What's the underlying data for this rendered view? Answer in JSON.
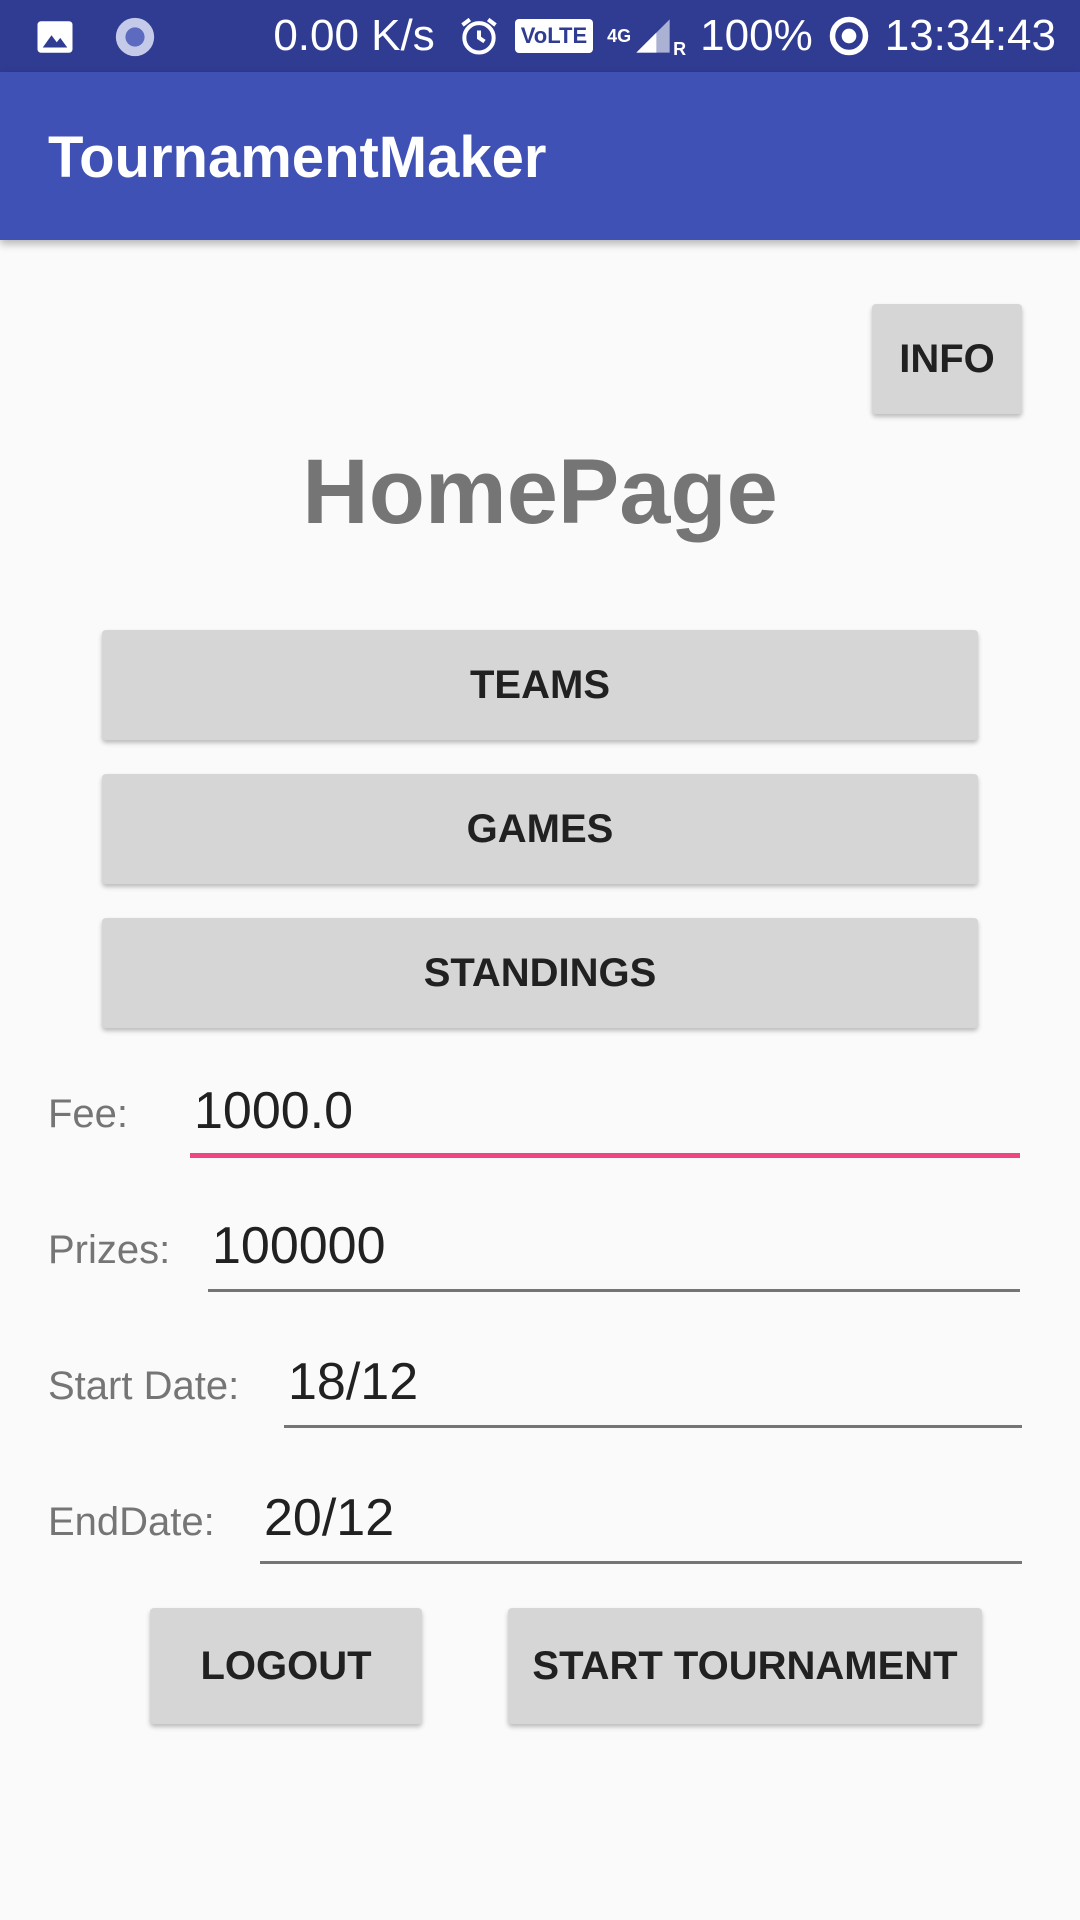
{
  "status_bar": {
    "icons": [
      "image-icon",
      "record-icon",
      "alarm-icon",
      "signal-icon",
      "battery-ring-icon"
    ],
    "network_speed": "0.00 K/s",
    "volte": "VoLTE",
    "network_type": "4G",
    "roaming": "R",
    "battery": "100%",
    "time": "13:34:43"
  },
  "app_bar": {
    "title": "TournamentMaker",
    "color": "#3f51b5"
  },
  "main": {
    "info_button": "INFO",
    "heading": "HomePage",
    "nav_buttons": {
      "teams": "TEAMS",
      "games": "GAMES",
      "standings": "STANDINGS"
    },
    "fields": {
      "fee": {
        "label": "Fee:",
        "value": "1000.0"
      },
      "prizes": {
        "label": "Prizes:",
        "value": "100000"
      },
      "start_date": {
        "label": "Start Date:",
        "value": "18/12"
      },
      "end_date": {
        "label": "EndDate:",
        "value": "20/12"
      }
    },
    "logout_button": "LOGOUT",
    "start_button": "START TOURNAMENT",
    "accent_color": "#ee4680"
  }
}
